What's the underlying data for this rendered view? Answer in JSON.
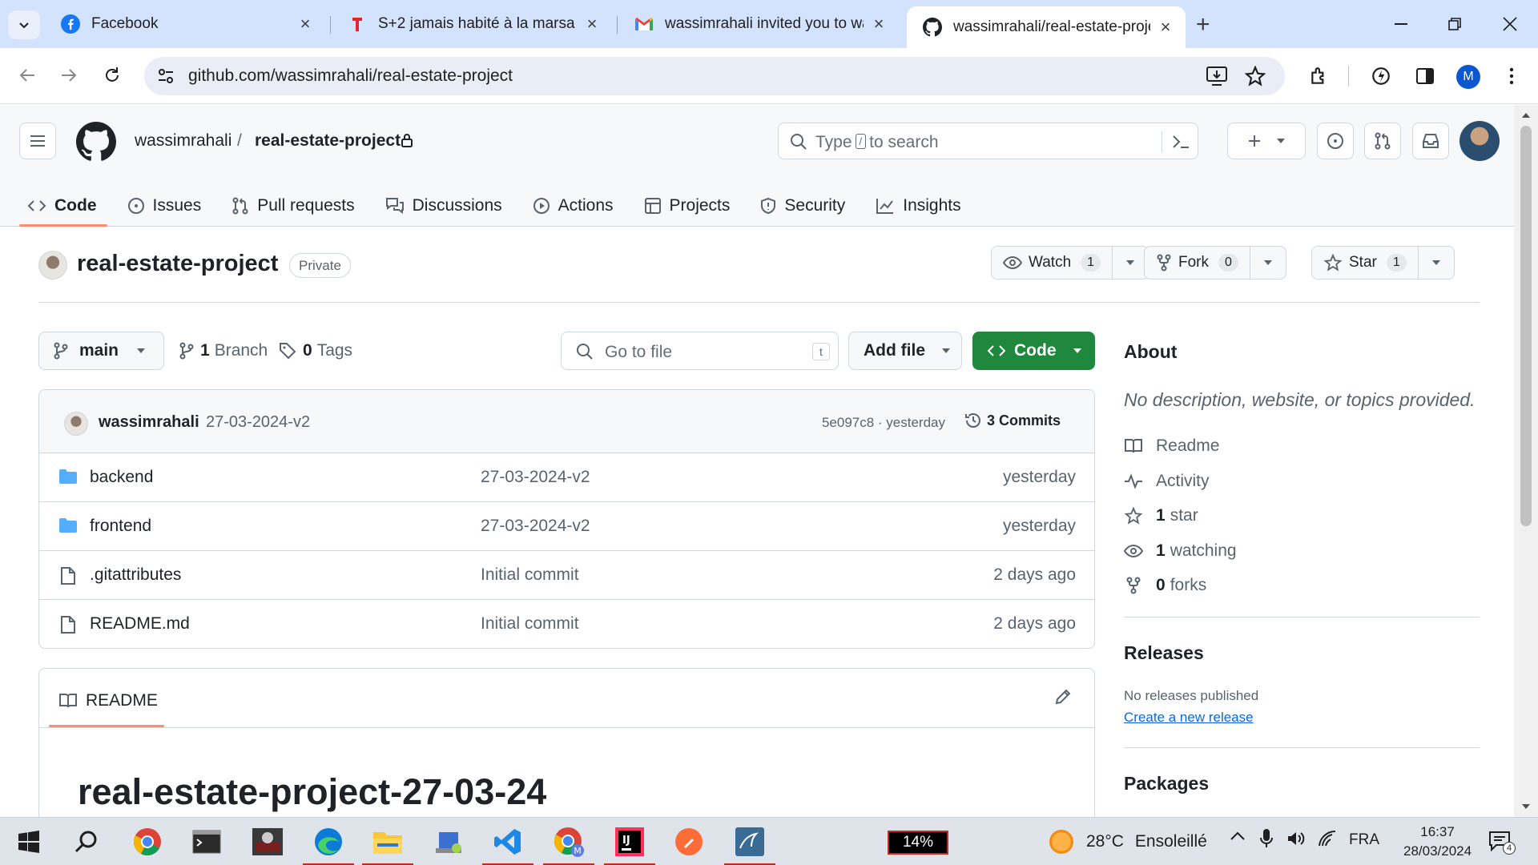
{
  "browser": {
    "tabs": [
      {
        "title": "Facebook",
        "icon": "facebook-icon"
      },
      {
        "title": "S+2 jamais habité à la marsa | T",
        "icon": "tayara-icon"
      },
      {
        "title": "wassimrahali invited you to was",
        "icon": "gmail-icon"
      },
      {
        "title": "wassimrahali/real-estate-projec",
        "icon": "github-icon"
      }
    ],
    "url": "github.com/wassimrahali/real-estate-project",
    "profile_initial": "M"
  },
  "github": {
    "owner": "wassimrahali",
    "crumb_sep": "/",
    "repo": "real-estate-project",
    "search": {
      "type": "Type",
      "key": "/",
      "rest": "to search"
    },
    "nav": [
      "Code",
      "Issues",
      "Pull requests",
      "Discussions",
      "Actions",
      "Projects",
      "Security",
      "Insights"
    ],
    "visibility": "Private",
    "watch": {
      "label": "Watch",
      "count": "1"
    },
    "fork": {
      "label": "Fork",
      "count": "0"
    },
    "star": {
      "label": "Star",
      "count": "1"
    },
    "branch": "main",
    "branches": {
      "count": "1",
      "label": "Branch"
    },
    "tags": {
      "count": "0",
      "label": "Tags"
    },
    "gotofile": {
      "placeholder": "Go to file",
      "key": "t"
    },
    "addfile": "Add file",
    "code": "Code",
    "last_commit": {
      "author": "wassimrahali",
      "message": "27-03-2024-v2",
      "sha_time": "5e097c8 · yesterday",
      "commits": "3 Commits"
    },
    "files": [
      {
        "name": "backend",
        "type": "folder",
        "message": "27-03-2024-v2",
        "date": "yesterday"
      },
      {
        "name": "frontend",
        "type": "folder",
        "message": "27-03-2024-v2",
        "date": "yesterday"
      },
      {
        "name": ".gitattributes",
        "type": "file",
        "message": "Initial commit",
        "date": "2 days ago"
      },
      {
        "name": "README.md",
        "type": "file",
        "message": "Initial commit",
        "date": "2 days ago"
      }
    ],
    "readme": {
      "tab": "README",
      "heading": "real-estate-project-27-03-24"
    },
    "about": {
      "title": "About",
      "description": "No description, website, or topics provided.",
      "readme": "Readme",
      "activity": "Activity",
      "stars": {
        "n": "1",
        "label": "star"
      },
      "watching": {
        "n": "1",
        "label": "watching"
      },
      "forks": {
        "n": "0",
        "label": "forks"
      }
    },
    "releases": {
      "title": "Releases",
      "none": "No releases published",
      "link": "Create a new release"
    },
    "packages": {
      "title": "Packages"
    }
  },
  "taskbar": {
    "battery": "14%",
    "weather": {
      "temp": "28°C",
      "desc": "Ensoleillé"
    },
    "lang": "FRA",
    "time": "16:37",
    "date": "28/03/2024",
    "notifications": "4"
  },
  "colors": {
    "accent_green": "#1f883d",
    "tab_underline": "#fd8c73",
    "link_blue": "#0969da"
  }
}
